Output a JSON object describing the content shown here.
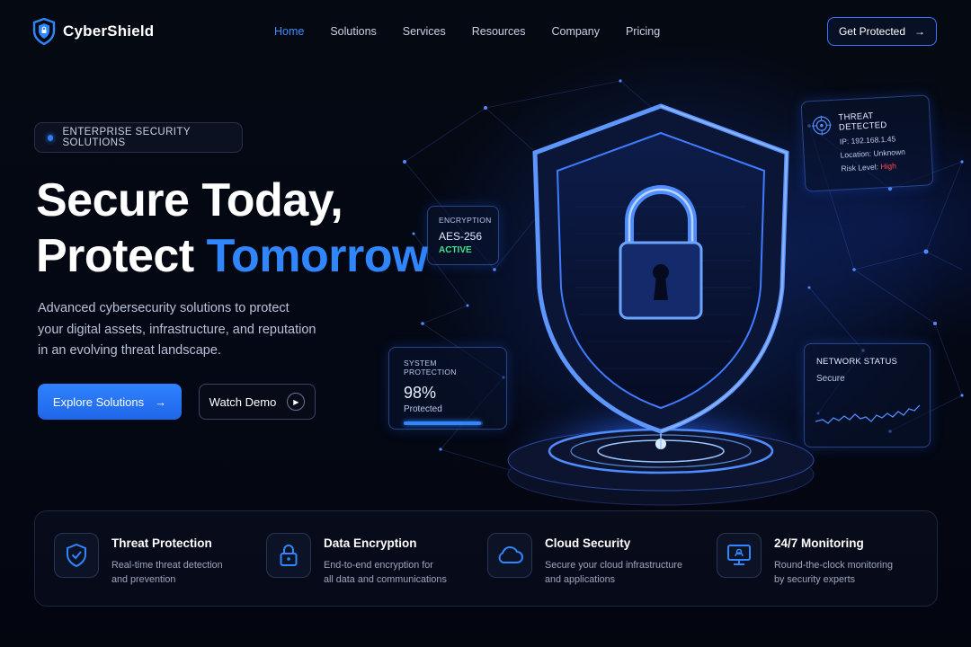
{
  "brand": {
    "name": "CyberShield"
  },
  "nav": {
    "items": [
      {
        "label": "Home",
        "active": true
      },
      {
        "label": "Solutions",
        "active": false
      },
      {
        "label": "Services",
        "active": false
      },
      {
        "label": "Resources",
        "active": false
      },
      {
        "label": "Company",
        "active": false
      },
      {
        "label": "Pricing",
        "active": false
      }
    ],
    "cta_label": "Get Protected"
  },
  "hero": {
    "badge": "ENTERPRISE SECURITY SOLUTIONS",
    "title_line1": "Secure Today,",
    "title_line2_prefix": "Protect ",
    "title_line2_accent": "Tomorrow",
    "lead_line1": "Advanced cybersecurity solutions to protect",
    "lead_line2": "your digital assets, infrastructure, and reputation",
    "lead_line3": "in an evolving threat landscape.",
    "primary_button": "Explore Solutions",
    "secondary_button": "Watch Demo"
  },
  "panels": {
    "encryption": {
      "label": "ENCRYPTION",
      "value": "AES-256",
      "status": "ACTIVE"
    },
    "system": {
      "label": "SYSTEM PROTECTION",
      "percent": "98%",
      "percent_value": 0.98,
      "sub": "Protected"
    },
    "threat": {
      "title": "THREAT DETECTED",
      "ip": "IP: 192.168.1.45",
      "location": "Location: Unknown",
      "risk_prefix": "Risk Level: ",
      "risk_value": "High"
    },
    "network": {
      "title": "NETWORK STATUS",
      "status": "Secure"
    }
  },
  "features": [
    {
      "title": "Threat Protection",
      "desc_line1": "Real-time threat detection",
      "desc_line2": "and prevention",
      "icon": "shield-check-icon"
    },
    {
      "title": "Data Encryption",
      "desc_line1": "End-to-end encryption for",
      "desc_line2": "all data and communications",
      "icon": "lock-icon"
    },
    {
      "title": "Cloud Security",
      "desc_line1": "Secure your cloud infrastructure",
      "desc_line2": "and applications",
      "icon": "cloud-icon"
    },
    {
      "title": "24/7 Monitoring",
      "desc_line1": "Round-the-clock monitoring",
      "desc_line2": "by security experts",
      "icon": "monitor-icon"
    }
  ],
  "colors": {
    "accent": "#2f86ff",
    "success": "#3ee38a",
    "danger": "#ff4b4b",
    "background": "#03060f"
  }
}
